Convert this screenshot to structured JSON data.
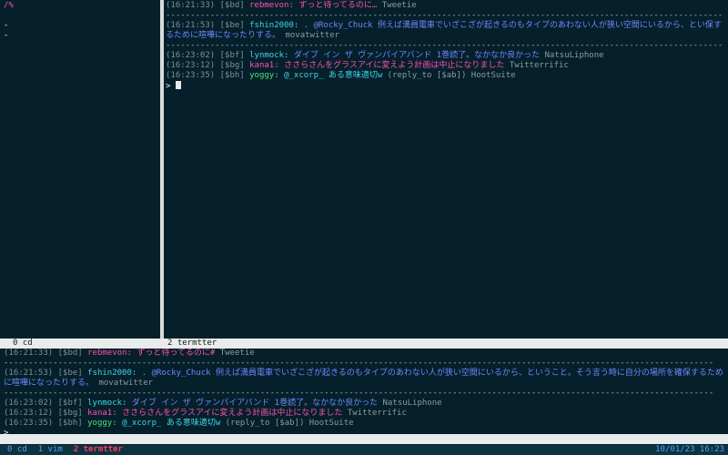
{
  "left_pane": {
    "path": "/%",
    "lines": [
      "-",
      "-"
    ]
  },
  "top_pane": {
    "tweets": [
      {
        "time": "(16:21:33)",
        "id": "[$bd]",
        "user": "rebmevon:",
        "text": "ずっと待ってるのに…",
        "client": "Tweetie",
        "user_color": "pink",
        "text_color": "pink"
      },
      {
        "time": "(16:21:53)",
        "id": "[$be]",
        "user": "fshin2000:",
        "text": ". @Rocky_Chuck 例えば満員電車でいざこざが起きるのもタイプのあわない人が狭い空間にいるから、とい保するために喧嘩になったりする。",
        "client": "movatwitter",
        "user_color": "cyan",
        "text_color": "blue"
      },
      {
        "time": "(16:23:02)",
        "id": "[$bf]",
        "user": "lynmock:",
        "text": "ダイブ イン ザ ヴァンパイアバンド 1巻読了。なかなか良かった",
        "client": "NatsuLiphone",
        "user_color": "cyan",
        "text_color": "blue"
      },
      {
        "time": "(16:23:12)",
        "id": "[$bg]",
        "user": "kana1:",
        "text": "ささらさんをグラスアイに変えよう計画は中止になりました",
        "client": "Twitterrific",
        "user_color": "pink",
        "text_color": "pink"
      },
      {
        "time": "(16:23:35)",
        "id": "[$bh]",
        "user": "yoggy:",
        "text": "@_xcorp_ ある意味適切w",
        "reply": "(reply_to [$ab])",
        "client": "HootSuite",
        "user_color": "green",
        "text_color": "cyan"
      }
    ],
    "prompt": ">"
  },
  "middle_status": {
    "left": "0 cd",
    "right": "2 termtter"
  },
  "bottom_pane": {
    "tweets": [
      {
        "time": "(16:21:33)",
        "id": "[$bd]",
        "user": "rebmevon:",
        "text": "ずっと待ってるのに#",
        "client": "Tweetie",
        "user_color": "pink",
        "text_color": "pink"
      },
      {
        "time": "(16:21:53)",
        "id": "[$be]",
        "user": "fshin2000:",
        "text": ". @Rocky_Chuck 例えば満員電車でいざこざが起きるのもタイプのあわない人が狭い空間にいるから、ということ。そう言う時に自分の場所を確保するために喧嘩になったりする。",
        "client": "movatwitter",
        "user_color": "cyan",
        "text_color": "blue"
      },
      {
        "time": "(16:23:02)",
        "id": "[$bf]",
        "user": "lynmock:",
        "text": "ダイブ イン ザ ヴァンパイアバンド 1巻読了。なかなか良かった",
        "client": "NatsuLiphone",
        "user_color": "cyan",
        "text_color": "blue"
      },
      {
        "time": "(16:23:12)",
        "id": "[$bg]",
        "user": "kana1:",
        "text": "ささらさんをグラスアイに変えよう計画は中止になりました",
        "client": "Twitterrific",
        "user_color": "pink",
        "text_color": "pink"
      },
      {
        "time": "(16:23:35)",
        "id": "[$bh]",
        "user": "yoggy:",
        "text": "@_xcorp_ ある意味適切w",
        "reply": "(reply_to [$ab])",
        "client": "HootSuite",
        "user_color": "green",
        "text_color": "cyan"
      }
    ],
    "prompt": ">"
  },
  "bottom_status": {
    "windows": [
      {
        "label": "0 cd",
        "active": false
      },
      {
        "label": "1 vim",
        "active": false
      },
      {
        "label": "2 termtter",
        "active": true
      }
    ],
    "datetime": "10/01/23 16:23"
  },
  "separator": "------------------------------------------------------------------------------------------------------------------------------------------------",
  "colors": {
    "background": "#05202b",
    "user_pink": "#ff4fb0",
    "user_cyan": "#46d4e6",
    "user_green": "#4ee07a",
    "text_blue": "#6e87ff",
    "status_bg": "#e9ecec",
    "bottom_status_bg": "#0d3340",
    "active_window": "#ff3b5c",
    "inactive_window": "#4aa3ff"
  }
}
